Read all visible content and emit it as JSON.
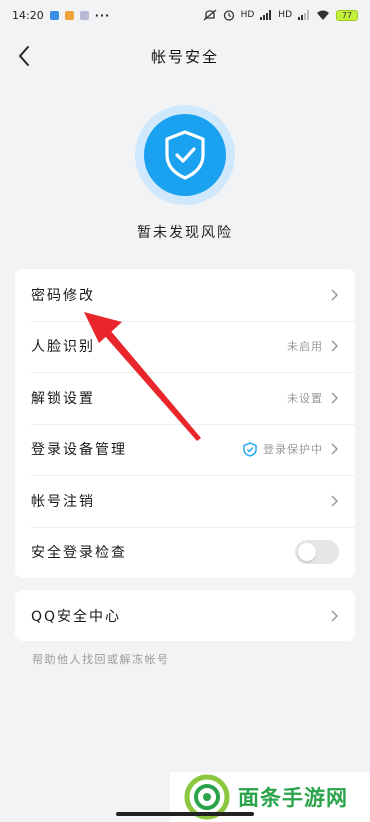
{
  "status_bar": {
    "time": "14:20",
    "more": "···",
    "hd1": "HD",
    "hd2": "HD",
    "battery": "77"
  },
  "nav": {
    "title": "帐号安全"
  },
  "risk_status": "暂未发现风险",
  "security_list": [
    {
      "label": "密码修改",
      "value": ""
    },
    {
      "label": "人脸识别",
      "value": "未启用"
    },
    {
      "label": "解锁设置",
      "value": "未设置"
    },
    {
      "label": "登录设备管理",
      "value": "登录保护中"
    },
    {
      "label": "帐号注销",
      "value": ""
    },
    {
      "label": "安全登录检查",
      "value": ""
    }
  ],
  "qq_center": {
    "label": "QQ安全中心"
  },
  "help_text": "帮助他人找回或解冻帐号",
  "watermark": "面条手游网",
  "colors": {
    "accent_blue": "#1aa1f0",
    "shield_halo": "#cfe8fb",
    "arrow_red": "#e8262b",
    "watermark_green": "#2aa34a",
    "toggle_off": "#e6e6e6"
  },
  "icons": {
    "back": "chevron-left-icon",
    "shield": "shield-check-icon",
    "row_chevron": "chevron-right-icon",
    "protect": "small-shield-check-icon"
  },
  "safe_login_check_enabled": false
}
